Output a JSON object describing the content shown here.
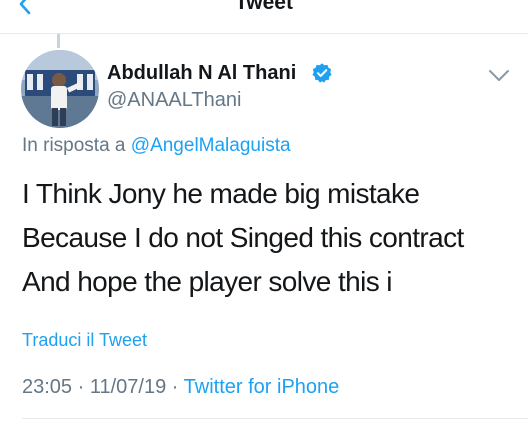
{
  "nav": {
    "title": "Tweet"
  },
  "author": {
    "display_name": "Abdullah N Al Thani",
    "handle": "@ANAALThani",
    "verified": true
  },
  "reply": {
    "prefix": "In risposta a",
    "mention": "@AngelMalaguista"
  },
  "tweet": {
    "lines": [
      "I Think Jony he made big mistake",
      "Because I do not Singed this contract",
      "And hope the player solve this i"
    ],
    "translate_label": "Traduci il Tweet"
  },
  "meta": {
    "time": "23:05",
    "date": "11/07/19",
    "separator": "·",
    "source": "Twitter for iPhone"
  },
  "icons": {
    "back": "chevron-left-icon",
    "verified": "verified-badge-icon",
    "menu": "chevron-down-icon"
  },
  "colors": {
    "accent": "#1da1f2",
    "text": "#14171a",
    "secondary": "#657786"
  }
}
